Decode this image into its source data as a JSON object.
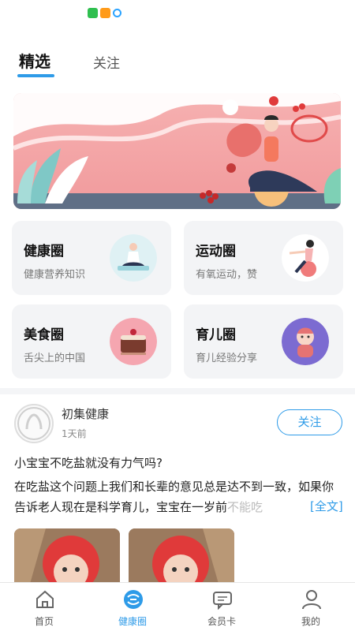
{
  "header": {
    "tabs": [
      {
        "label": "精选",
        "active": true
      },
      {
        "label": "关注",
        "active": false
      }
    ]
  },
  "status_bar": {
    "icons": [
      "green-app-icon",
      "orange-play-icon",
      "blue-circle-icon"
    ]
  },
  "banner": {
    "image": "pink yoga illustration banner"
  },
  "categories": [
    {
      "title": "健康圈",
      "subtitle": "健康营养知识",
      "icon": "meditation-icon"
    },
    {
      "title": "运动圈",
      "subtitle": "有氧运动，赞",
      "icon": "fitness-icon"
    },
    {
      "title": "美食圈",
      "subtitle": "舌尖上的中国",
      "icon": "cake-icon"
    },
    {
      "title": "育儿圈",
      "subtitle": "育儿经验分享",
      "icon": "baby-icon"
    }
  ],
  "post": {
    "author": "初集健康",
    "time": "1天前",
    "follow_label": "关注",
    "title": "小宝宝不吃盐就没有力气吗?",
    "body": "在吃盐这个问题上我们和长辈的意见总是达不到一致，如果你告诉老人现在是科学育儿，宝宝在一岁前",
    "body_fade": "不能吃",
    "read_more": "[全文]"
  },
  "bottom_nav": [
    {
      "label": "首页",
      "icon": "home-icon",
      "active": false
    },
    {
      "label": "健康圈",
      "icon": "health-circle-icon",
      "active": true
    },
    {
      "label": "会员卡",
      "icon": "chat-icon",
      "active": false
    },
    {
      "label": "我的",
      "icon": "user-icon",
      "active": false
    }
  ],
  "colors": {
    "accent": "#2e9be8",
    "banner": "#f19a9c",
    "card_bg": "#f3f4f6"
  }
}
